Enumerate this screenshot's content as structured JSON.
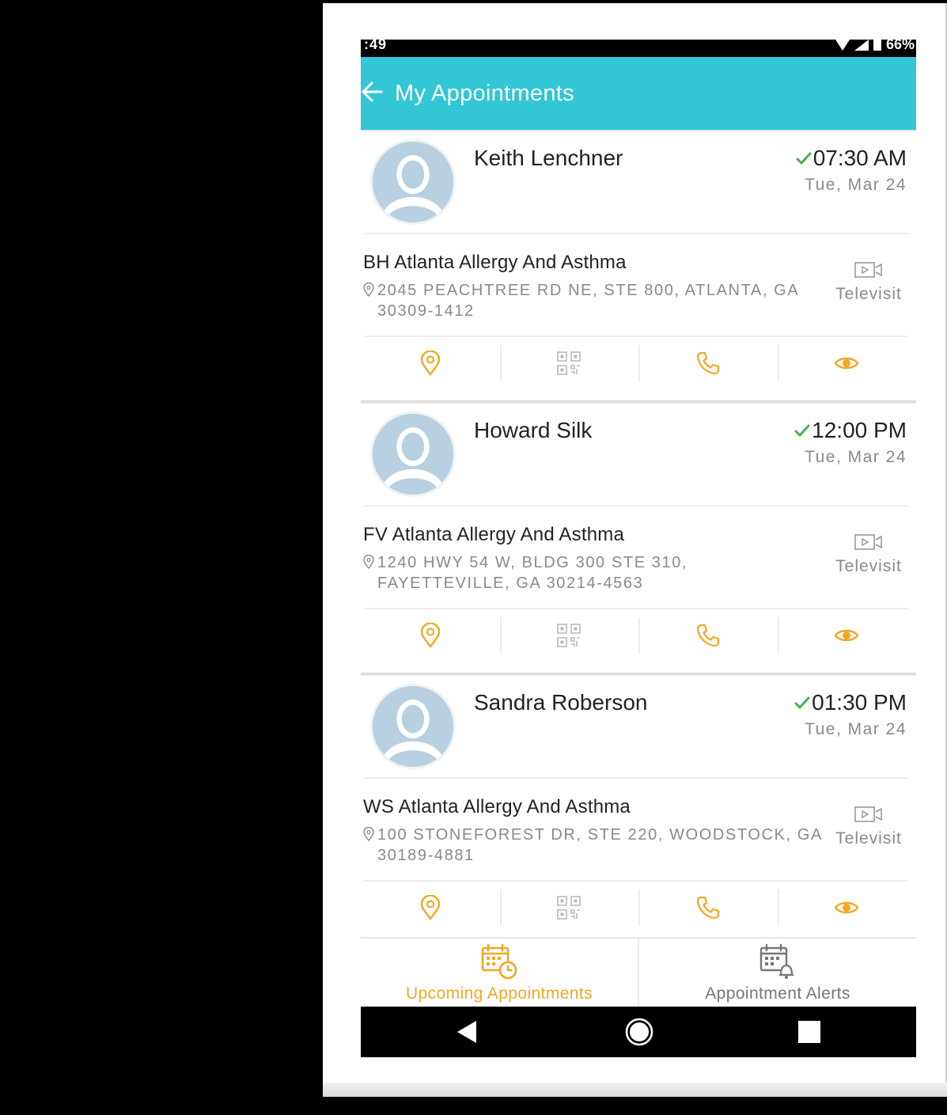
{
  "statusbar": {
    "time": ":49",
    "right": "66%"
  },
  "appbar": {
    "title": "My Appointments",
    "back_icon": "arrow-left-icon"
  },
  "colors": {
    "appbar": "#33c6d6",
    "accent": "#f5a623",
    "check": "#4caf50",
    "avatar": "#b8d0e0"
  },
  "appointments": [
    {
      "patient": "Keith Lenchner",
      "time": "07:30 AM",
      "date": "Tue, Mar 24",
      "clinic": "BH Atlanta Allergy And Asthma",
      "address": "2045 PEACHTREE RD NE, STE 800, ATLANTA, GA 30309-1412",
      "visit_type": "Televisit"
    },
    {
      "patient": "Howard Silk",
      "time": "12:00 PM",
      "date": "Tue, Mar 24",
      "clinic": "FV Atlanta Allergy And Asthma",
      "address": "1240 HWY 54  W, BLDG 300 STE 310, FAYETTEVILLE, GA 30214-4563",
      "visit_type": "Televisit"
    },
    {
      "patient": "Sandra Roberson",
      "time": "01:30 PM",
      "date": "Tue, Mar 24",
      "clinic": "WS Atlanta Allergy And Asthma",
      "address": "100 STONEFOREST DR, STE 220, WOODSTOCK, GA 30189-4881",
      "visit_type": "Televisit"
    }
  ],
  "actions": [
    "map-pin-icon",
    "qr-code-icon",
    "phone-icon",
    "eye-icon"
  ],
  "bottomnav": {
    "upcoming_label": "Upcoming Appointments",
    "alerts_label": "Appointment Alerts"
  }
}
